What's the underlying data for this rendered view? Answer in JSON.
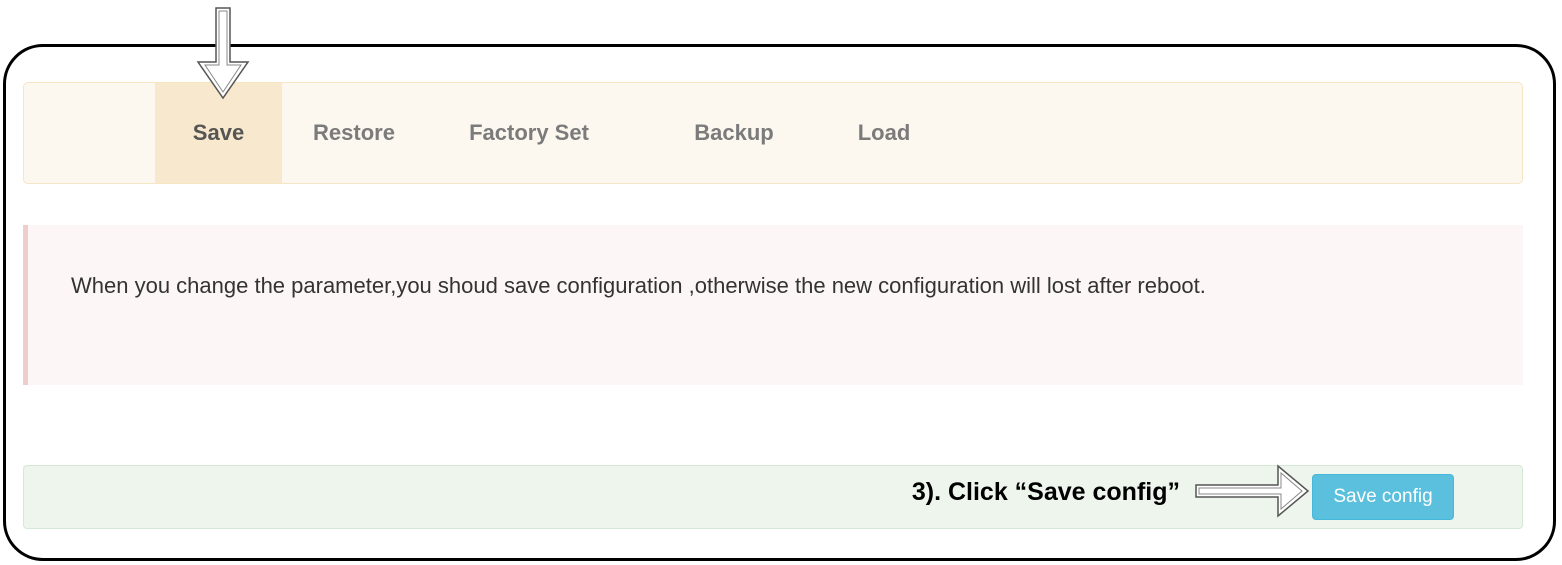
{
  "nav": {
    "tabs": [
      {
        "label": "Save",
        "active": true
      },
      {
        "label": "Restore",
        "active": false
      },
      {
        "label": "Factory Set",
        "active": false
      },
      {
        "label": "Backup",
        "active": false
      },
      {
        "label": "Load",
        "active": false
      }
    ]
  },
  "alert": {
    "text": "When you change the parameter,you shoud save configuration ,otherwise the new configuration will lost after reboot."
  },
  "footer": {
    "save_button_label": "Save config"
  },
  "annotation": {
    "text": "3). Click “Save config”"
  },
  "icons": [
    "down-arrow-icon",
    "right-arrow-icon"
  ],
  "colors": {
    "navbar_bg": "#fcf8f0",
    "active_tab_bg": "#f8e8cd",
    "alert_bg": "#fdf6f6",
    "footer_bg": "#edf5ed",
    "button_bg": "#5bc0de"
  }
}
